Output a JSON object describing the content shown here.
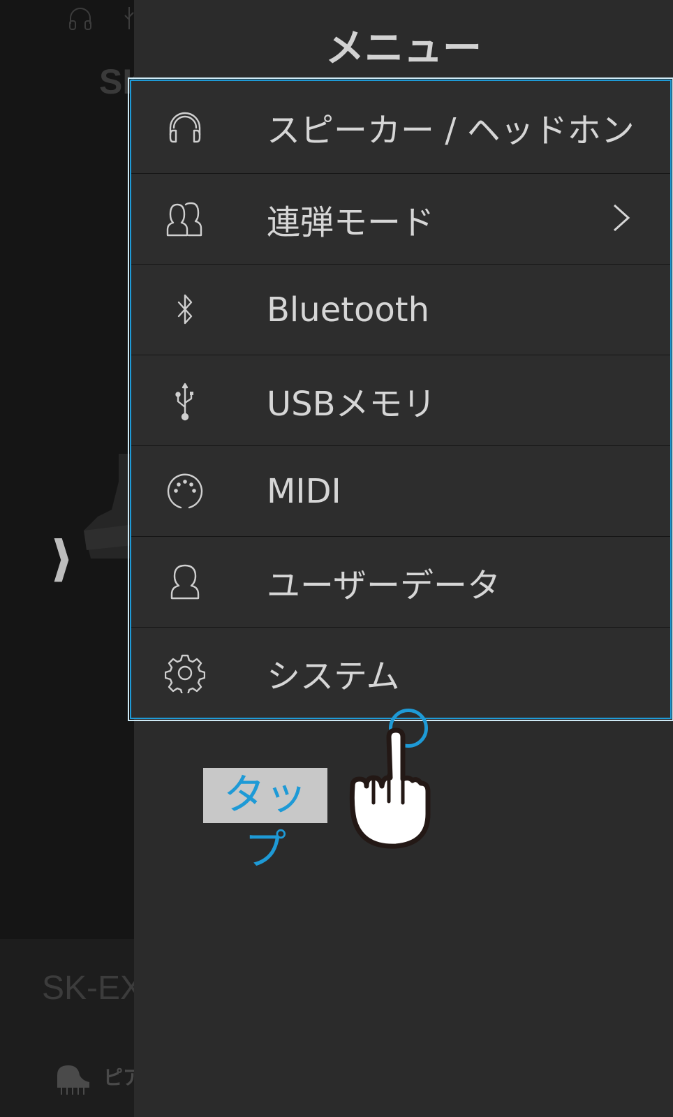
{
  "background": {
    "model_name_top": "SK",
    "model_name_bottom": "SK-EX",
    "piano_label": "ピア",
    "expand_arrow": "⟩⟩",
    "icons": [
      "headphones-icon",
      "usb-icon",
      "grand-piano-icon",
      "piano-icon"
    ]
  },
  "menu": {
    "title": "メニュー",
    "items": [
      {
        "label": "スピーカー / ヘッドホン",
        "icon": "headphones-icon"
      },
      {
        "label": "連弾モード",
        "icon": "duet-icon",
        "has_chevron": true
      },
      {
        "label": "Bluetooth",
        "icon": "bluetooth-icon"
      },
      {
        "label": "USBメモリ",
        "icon": "usb-icon"
      },
      {
        "label": "MIDI",
        "icon": "midi-icon"
      },
      {
        "label": "ユーザーデータ",
        "icon": "user-icon"
      },
      {
        "label": "システム",
        "icon": "gear-icon"
      }
    ]
  },
  "annotation": {
    "tap_label": "タップ",
    "highlight_color": "#1e9ad6"
  }
}
